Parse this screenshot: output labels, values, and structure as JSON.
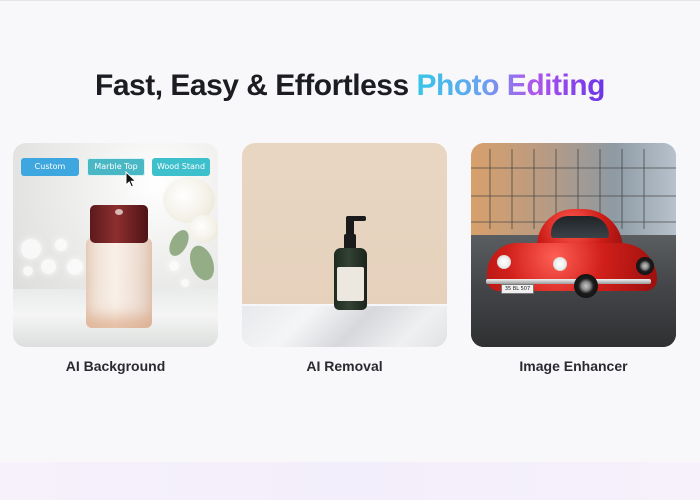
{
  "section": {
    "headline_plain": "Fast, Easy & Effortless ",
    "headline_accent": "Photo Editing",
    "accent_gradient": [
      "#35c6e8",
      "#b055ec",
      "#6a35e8"
    ]
  },
  "cards": [
    {
      "caption": "AI Background",
      "chips": [
        "Custom",
        "Marble Top",
        "Wood Stand"
      ],
      "chip_colors": [
        "#3fa7df",
        "#49b7c4",
        "#3dbfcc"
      ]
    },
    {
      "caption": "AI Removal"
    },
    {
      "caption": "Image Enhancer",
      "plate_text": "35 BL 507"
    }
  ],
  "icons": {
    "cursor": "mouse-pointer-icon"
  }
}
